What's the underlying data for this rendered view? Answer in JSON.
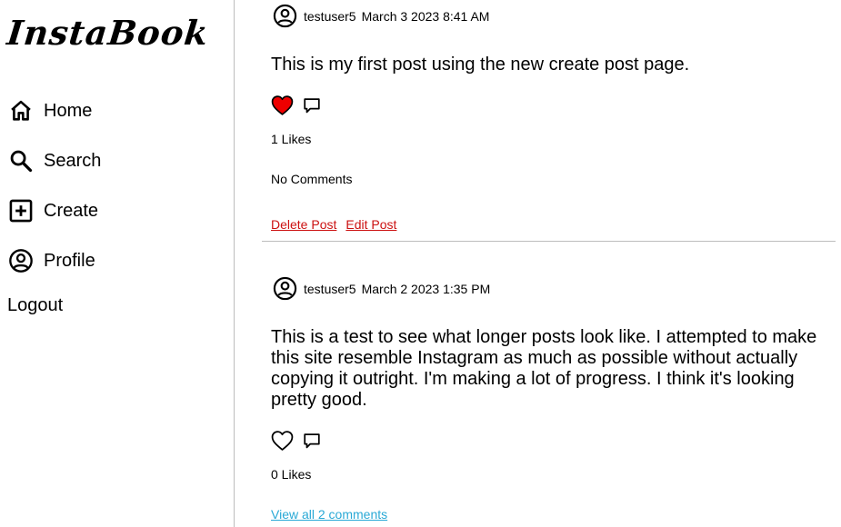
{
  "app": {
    "logo": "InstaBook"
  },
  "nav": {
    "home": "Home",
    "search": "Search",
    "create": "Create",
    "profile": "Profile",
    "logout": "Logout"
  },
  "posts": [
    {
      "user": "testuser5",
      "date": "March 3 2023 8:41 AM",
      "body": "This is my first post using the new create post page.",
      "liked": true,
      "likes": "1 Likes",
      "comments": "No Comments",
      "delete_label": "Delete Post",
      "edit_label": "Edit Post"
    },
    {
      "user": "testuser5",
      "date": "March 2 2023 1:35 PM",
      "body": "This is a test to see what longer posts look like. I attempted to make this site resemble Instagram as much as possible without actually copying it outright. I'm making a lot of progress. I think it's looking pretty good.",
      "liked": false,
      "likes": "0 Likes",
      "comments": "View all 2 comments"
    }
  ],
  "colors": {
    "heart_liked": "#ee0000",
    "danger_link": "#cc1111",
    "info_link": "#29a9d6",
    "divider": "#bdbdbd"
  }
}
